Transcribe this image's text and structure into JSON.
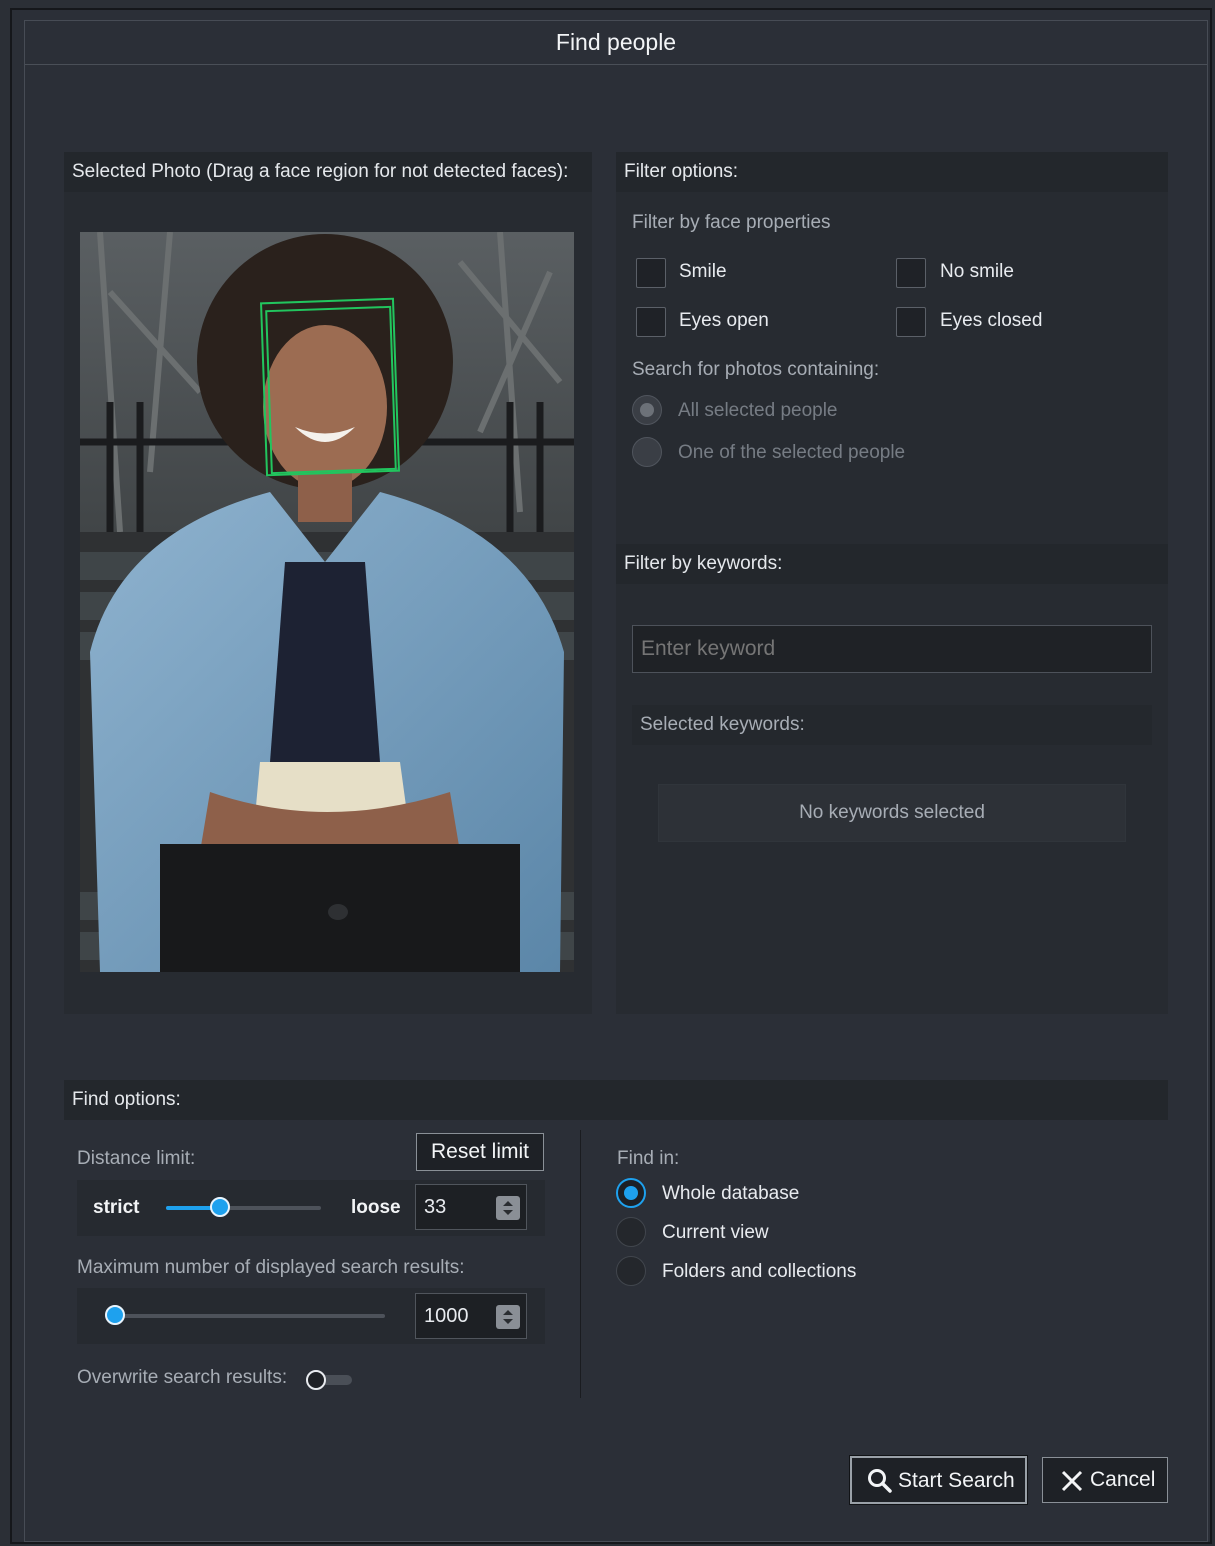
{
  "dialog": {
    "title": "Find people"
  },
  "photo_panel": {
    "header": "Selected Photo (Drag a face region for not detected faces):"
  },
  "filter_panel": {
    "header": "Filter options:",
    "face_props_label": "Filter by face properties",
    "checkboxes": {
      "smile": {
        "label": "Smile",
        "checked": false
      },
      "no_smile": {
        "label": "No smile",
        "checked": false
      },
      "eyes_open": {
        "label": "Eyes open",
        "checked": false
      },
      "eyes_closed": {
        "label": "Eyes closed",
        "checked": false
      }
    },
    "containing_label": "Search for photos containing:",
    "containing_options": {
      "all": {
        "label": "All selected people",
        "selected": true
      },
      "one": {
        "label": "One of the selected people",
        "selected": false
      }
    }
  },
  "keywords_panel": {
    "header": "Filter by keywords:",
    "input_placeholder": "Enter keyword",
    "selected_label": "Selected keywords:",
    "empty_text": "No keywords selected"
  },
  "find_options": {
    "header": "Find options:",
    "distance_label": "Distance limit:",
    "reset_label": "Reset limit",
    "strict_label": "strict",
    "loose_label": "loose",
    "distance_value": "33",
    "distance_slider_fraction": 0.35,
    "max_results_label": "Maximum number of displayed search results:",
    "max_results_value": "1000",
    "max_results_slider_fraction": 0.0,
    "overwrite_label": "Overwrite search results:",
    "overwrite_on": false,
    "find_in_label": "Find in:",
    "find_in_options": {
      "whole": {
        "label": "Whole database",
        "selected": true
      },
      "current": {
        "label": "Current view",
        "selected": false
      },
      "folders": {
        "label": "Folders and collections",
        "selected": false
      }
    }
  },
  "buttons": {
    "start_search": "Start Search",
    "cancel": "Cancel"
  },
  "colors": {
    "accent": "#1ea1ee",
    "face_box": "#22c55e"
  },
  "icons": {
    "search": "search-icon",
    "cancel": "close-icon"
  }
}
